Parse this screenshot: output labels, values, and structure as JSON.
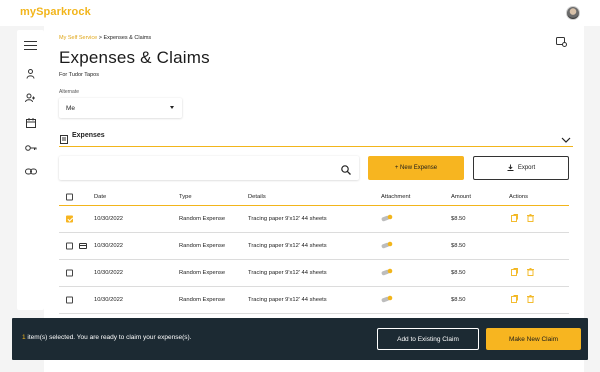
{
  "app": {
    "brand": "mySparkrock"
  },
  "breadcrumb": {
    "parent": "My Self Service",
    "separator": ">",
    "current": "Expenses & Claims"
  },
  "page": {
    "title": "Expenses & Claims",
    "subtitle": "For Tudor Tapos"
  },
  "alternate": {
    "label": "Alternate",
    "value": "Me"
  },
  "section": {
    "title": "Expenses"
  },
  "toolbar": {
    "new_label": "+ New Expense",
    "export_label": "Export"
  },
  "table": {
    "headers": {
      "date": "Date",
      "type": "Type",
      "details": "Details",
      "attachment": "Attachment",
      "amount": "Amount",
      "actions": "Actions"
    },
    "rows": [
      {
        "checked": true,
        "card": false,
        "date": "10/30/2022",
        "type": "Random Expense",
        "details": "Tracing paper 9'x12' 44 sheets",
        "amount": "$8.50",
        "actions": true
      },
      {
        "checked": false,
        "card": true,
        "date": "10/30/2022",
        "type": "Random Expense",
        "details": "Tracing paper 9'x12' 44 sheets",
        "amount": "$8.50",
        "actions": false
      },
      {
        "checked": false,
        "card": false,
        "date": "10/30/2022",
        "type": "Random Expense",
        "details": "Tracing paper 9'x12' 44 sheets",
        "amount": "$8.50",
        "actions": true
      },
      {
        "checked": false,
        "card": false,
        "date": "10/30/2022",
        "type": "Random Expense",
        "details": "Tracing paper 9'x12' 44 sheets",
        "amount": "$8.50",
        "actions": true
      }
    ]
  },
  "footer": {
    "count": "1",
    "message": " item(s) selected. You are ready to claim your expense(s).",
    "add_existing_label": "Add to Existing Claim",
    "make_new_label": "Make New Claim"
  },
  "colors": {
    "accent": "#f7b520",
    "footer_bg": "#1c2a33",
    "brand": "#f2b51b"
  }
}
